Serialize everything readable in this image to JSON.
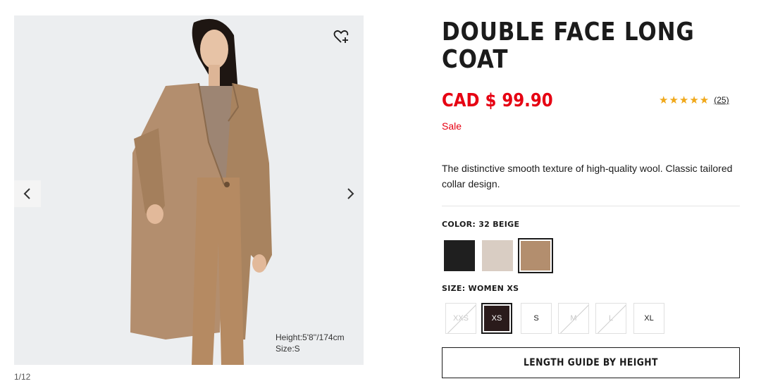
{
  "product": {
    "title": "DOUBLE FACE LONG COAT",
    "price": "CAD $ 99.90",
    "sale": "Sale",
    "rating": {
      "stars": "★★★★★",
      "value": 4.5,
      "max": 5,
      "reviews": "(25)",
      "star_color": "#f0a81a"
    },
    "description": "The distinctive smooth texture of high-quality wool. Classic tailored collar design."
  },
  "gallery": {
    "counter": "1/12",
    "model_height": "Height:5'8''/174cm",
    "model_size": "Size:S",
    "icons": {
      "wishlist": "heart-plus-icon",
      "prev": "chevron-left-icon",
      "next": "chevron-right-icon"
    }
  },
  "color": {
    "label": "COLOR: 32 BEIGE",
    "swatches": [
      {
        "name": "black",
        "hex": "#1f1f1f",
        "selected": false
      },
      {
        "name": "natural",
        "hex": "#d9cdc3",
        "selected": false
      },
      {
        "name": "beige",
        "hex": "#b38e6e",
        "selected": true
      }
    ]
  },
  "size": {
    "label": "SIZE: WOMEN XS",
    "options": [
      {
        "label": "XXS",
        "available": false,
        "selected": false
      },
      {
        "label": "XS",
        "available": true,
        "selected": true
      },
      {
        "label": "S",
        "available": true,
        "selected": false
      },
      {
        "label": "M",
        "available": false,
        "selected": false
      },
      {
        "label": "L",
        "available": false,
        "selected": false
      },
      {
        "label": "XL",
        "available": true,
        "selected": false
      }
    ]
  },
  "actions": {
    "length_guide": "LENGTH GUIDE BY HEIGHT"
  },
  "colors": {
    "accent_red": "#e60012",
    "text": "#1b1b1b",
    "selected_size_bg": "#2a1b1b"
  }
}
